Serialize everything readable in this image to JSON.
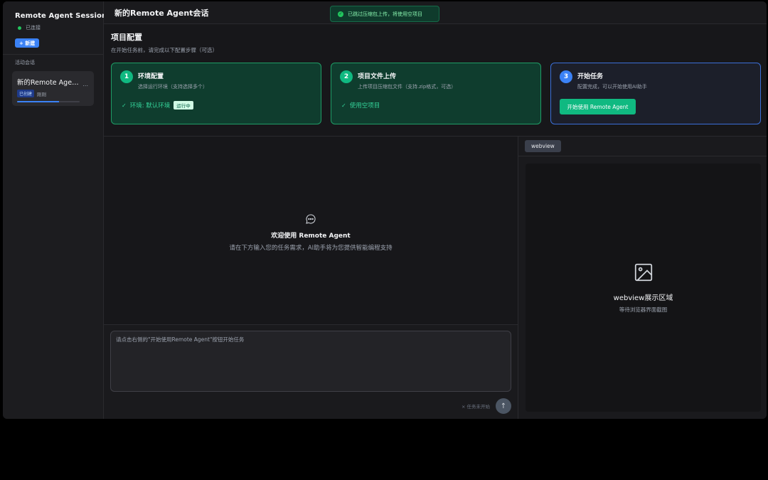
{
  "sidebar": {
    "title": "Remote Agent Sessions",
    "status": "已连接",
    "new_button": "+ 新建",
    "section_label": "活动会话",
    "sessions": [
      {
        "title": "新的Remote Agent会话",
        "badge": "已创建",
        "time": "刚刚",
        "more": "...",
        "progress": 0.67
      }
    ]
  },
  "header": {
    "title": "新的Remote Agent会话"
  },
  "toast": {
    "message": "已跳过压缩包上传，将使用空项目"
  },
  "config": {
    "title": "项目配置",
    "subtitle": "在开始任务前，请完成以下配置步骤（可选）",
    "steps": [
      {
        "num": "1",
        "title": "环境配置",
        "desc": "选择运行环境（支持选择多个）",
        "result": "环境: 默认环境",
        "badge": "运行中"
      },
      {
        "num": "2",
        "title": "项目文件上传",
        "desc": "上传项目压缩包文件（支持.zip格式，可选）",
        "result": "使用空项目"
      },
      {
        "num": "3",
        "title": "开始任务",
        "desc": "配置完成，可以开始使用AI助手",
        "button": "开始使用 Remote Agent"
      }
    ]
  },
  "chat": {
    "welcome_title": "欢迎使用 Remote Agent",
    "welcome_text": "请在下方输入您的任务需求，AI助手将为您提供智能编程支持",
    "input_placeholder": "请点击右侧的\"开始使用Remote Agent\"按钮开始任务",
    "status": "× 任务未开始",
    "send_icon": "↑"
  },
  "webview": {
    "tab": "webview",
    "title": "webview展示区域",
    "subtitle": "等待浏览器界面截图"
  },
  "colors": {
    "accent_blue": "#3b82f6",
    "accent_green": "#10b981",
    "background": "#17171a"
  }
}
